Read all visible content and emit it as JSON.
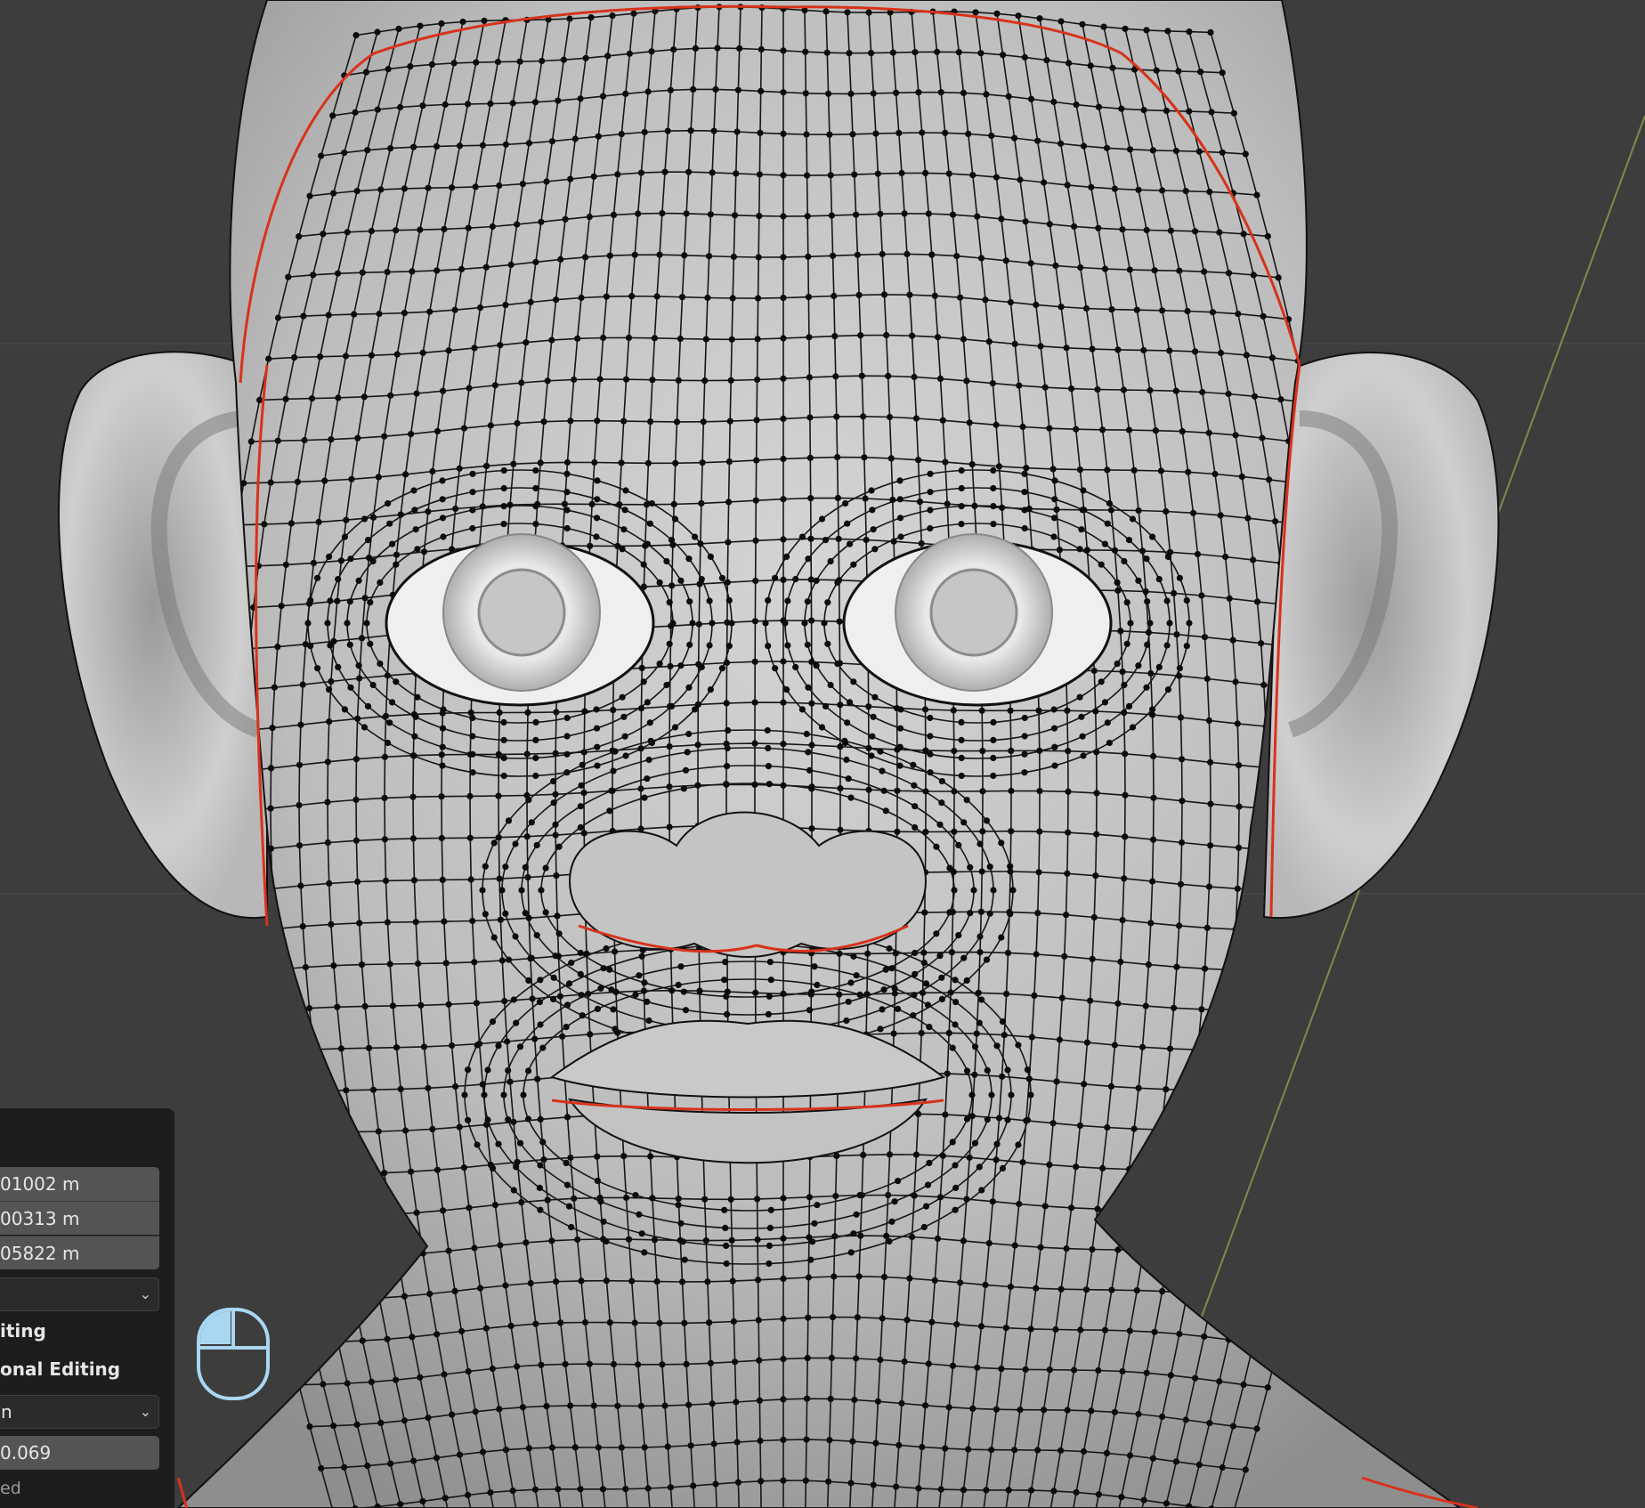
{
  "viewport": {
    "background": "#3d3d3d",
    "mesh_color": "#c9c9c9",
    "wire_color": "#111111",
    "seam_color": "#d8321b",
    "axis_color": "#7d8c4a"
  },
  "operator_panel": {
    "move_x": "01002 m",
    "move_y": "00313 m",
    "move_z": "05822 m",
    "orientation_value": "",
    "proportional_editing_partial": "iting",
    "connected_partial": "onal Editing",
    "falloff_partial": "n",
    "size_value": "0.069",
    "projected_partial": "ed"
  },
  "icons": {
    "mouse": "mouse-left-click-icon",
    "chevron": "chevron-down-icon"
  }
}
